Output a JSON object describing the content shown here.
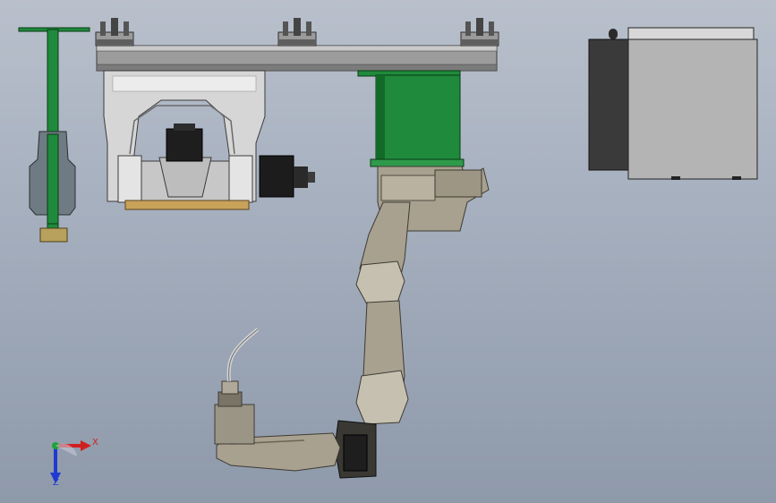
{
  "viewport": {
    "background_top": "#b9c0cc",
    "background_bottom": "#8e99aa"
  },
  "colors": {
    "green": "#1f8a3c",
    "green_dark": "#126a28",
    "steel": "#d7d7d7",
    "steel_dark": "#6d6d6d",
    "robot": "#a8a190",
    "robot_dark": "#4f4a40",
    "controller": "#b4b4b4",
    "controller_side": "#3a3a3a",
    "axis_x": "#d11f1f",
    "axis_y": "#1fa33a",
    "axis_z": "#1f3ad1"
  },
  "triad": {
    "x_label": "X",
    "z_label": "Z"
  },
  "icons": [
    "axis-triad-icon"
  ]
}
